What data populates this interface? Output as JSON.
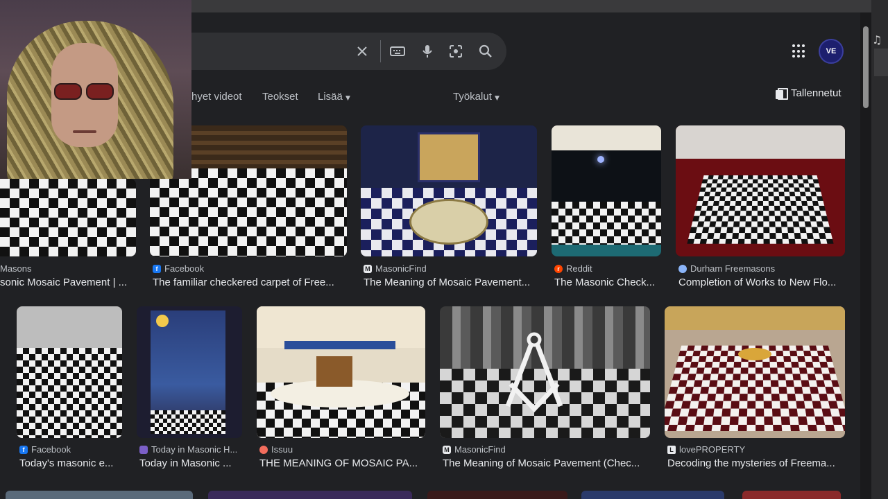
{
  "search": {
    "clear_icon": "close-icon",
    "keyboard_icon": "keyboard-icon",
    "mic_icon": "microphone-icon",
    "lens_icon": "lens-icon",
    "search_icon": "search-icon"
  },
  "header": {
    "apps_icon": "apps-grid-icon",
    "avatar_text": "VE"
  },
  "tabs": {
    "videos": "hyet videot",
    "books": "Teokset",
    "more": "Lisää",
    "tools": "Työkalut"
  },
  "saved_label": "Tallennetut",
  "results_row1": [
    {
      "source": "Masons",
      "title": "sonic Mosaic Pavement | ..."
    },
    {
      "source": "Facebook",
      "title": "The familiar checkered carpet of Free..."
    },
    {
      "source": "MasonicFind",
      "title": "The Meaning of Mosaic Pavement..."
    },
    {
      "source": "Reddit",
      "title": "The Masonic Check..."
    },
    {
      "source": "Durham Freemasons",
      "title": "Completion of Works to New Flo..."
    }
  ],
  "results_row2": [
    {
      "source": "Facebook",
      "title": "Today's masonic e..."
    },
    {
      "source": "Today in Masonic H...",
      "title": "Today in Masonic ..."
    },
    {
      "source": "Issuu",
      "title": "THE MEANING OF MOSAIC PA..."
    },
    {
      "source": "MasonicFind",
      "title": "The Meaning of Mosaic Pavement (Chec..."
    },
    {
      "source": "lovePROPERTY",
      "title": "Decoding the mysteries of Freema..."
    }
  ],
  "colors": {
    "background": "#202124",
    "facebook": "#1877f2",
    "reddit": "#ff4500",
    "issuu": "#f36d5d"
  }
}
